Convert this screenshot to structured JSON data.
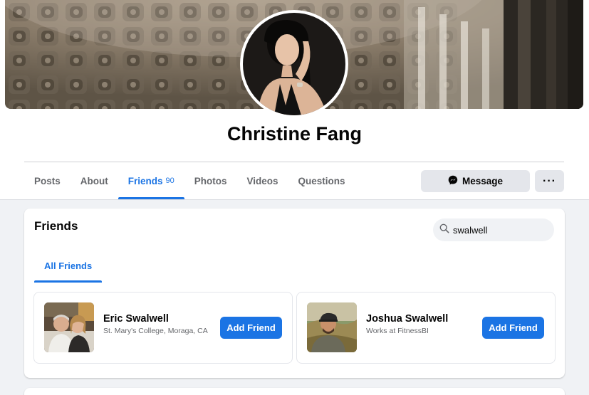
{
  "profile": {
    "name": "Christine Fang"
  },
  "nav": {
    "tabs": [
      {
        "label": "Posts"
      },
      {
        "label": "About"
      },
      {
        "label": "Friends",
        "count": "90"
      },
      {
        "label": "Photos"
      },
      {
        "label": "Videos"
      },
      {
        "label": "Questions"
      }
    ],
    "active_tab": "Friends",
    "message_label": "Message",
    "more_label": "···",
    "message_icon": "messenger-icon",
    "more_icon": "more-dots-icon"
  },
  "friends_section": {
    "title": "Friends",
    "search_value": "swalwell",
    "search_icon": "search-icon",
    "subtab": "All Friends",
    "results": [
      {
        "name": "Eric Swalwell",
        "meta": "St. Mary's College, Moraga, CA",
        "button": "Add Friend"
      },
      {
        "name": "Joshua Swalwell",
        "meta": "Works at FitnessBI",
        "button": "Add Friend"
      }
    ]
  },
  "colors": {
    "accent": "#1b74e4",
    "page_bg": "#f0f2f5",
    "secondary_button": "#e4e6eb",
    "muted_text": "#65676b"
  }
}
